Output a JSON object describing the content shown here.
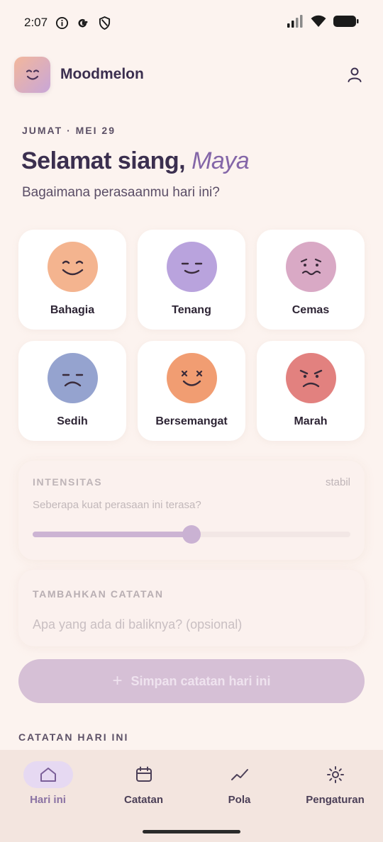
{
  "status_bar": {
    "time": "2:07",
    "icons": [
      "info-icon",
      "google-icon",
      "shield-icon",
      "signal-icon",
      "wifi-icon",
      "battery-icon"
    ]
  },
  "header": {
    "app_name": "Moodmelon",
    "logo_icon": "smile-face-icon",
    "profile_icon": "user-icon"
  },
  "date_line": "JUMAT · MEI 29",
  "greeting": {
    "prefix": "Selamat siang,",
    "name": "Maya"
  },
  "question": "Bagaimana perasaanmu hari ini?",
  "moods": [
    {
      "label": "Bahagia",
      "icon": "happy-face-icon",
      "color": "#f4b48f"
    },
    {
      "label": "Tenang",
      "icon": "calm-face-icon",
      "color": "#b9a3dd"
    },
    {
      "label": "Cemas",
      "icon": "anxious-face-icon",
      "color": "#d9a9c5"
    },
    {
      "label": "Sedih",
      "icon": "sad-face-icon",
      "color": "#95a3cf"
    },
    {
      "label": "Bersemangat",
      "icon": "excited-face-icon",
      "color": "#f19d72"
    },
    {
      "label": "Marah",
      "icon": "angry-face-icon",
      "color": "#e2817f"
    }
  ],
  "intensity": {
    "title": "INTENSITAS",
    "status": "stabil",
    "subtitle": "Seberapa kuat perasaan ini terasa?",
    "value": 0.5
  },
  "note": {
    "title": "TAMBAHKAN CATATAN",
    "placeholder": "Apa yang ada di baliknya? (opsional)"
  },
  "save_button": {
    "icon": "plus-icon",
    "label": "Simpan catatan hari ini"
  },
  "today_heading": "CATATAN HARI INI",
  "nav": [
    {
      "label": "Hari ini",
      "icon": "home-icon",
      "active": true
    },
    {
      "label": "Catatan",
      "icon": "calendar-icon",
      "active": false
    },
    {
      "label": "Pola",
      "icon": "trend-icon",
      "active": false
    },
    {
      "label": "Pengaturan",
      "icon": "gear-icon",
      "active": false
    }
  ],
  "colors": {
    "accent": "#8466a8",
    "background": "#fcf3ef"
  }
}
